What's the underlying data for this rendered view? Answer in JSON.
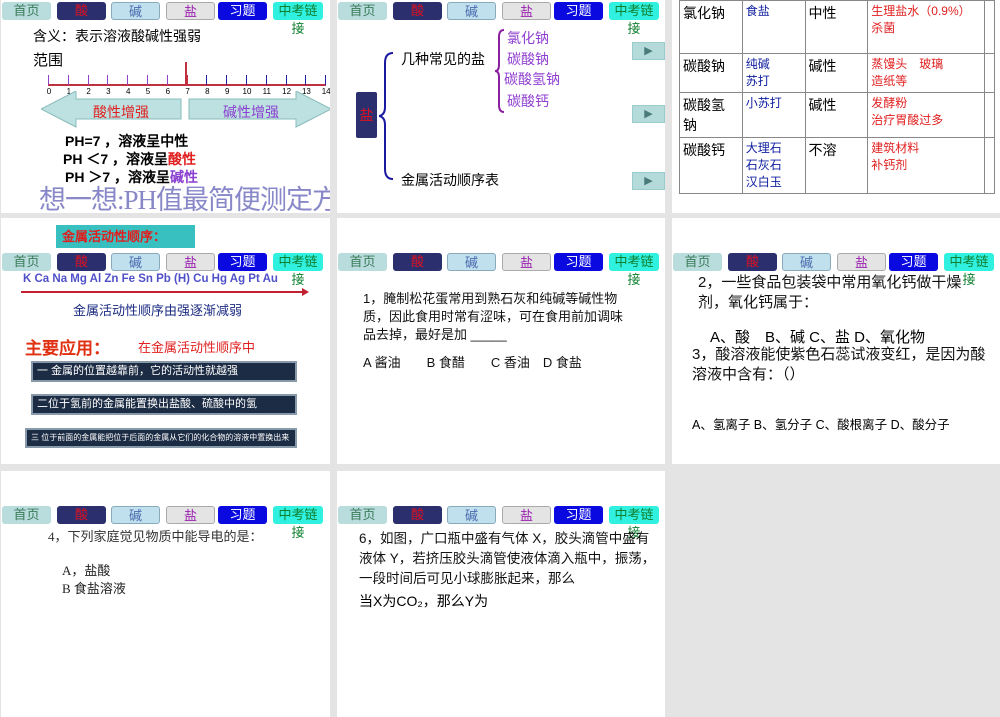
{
  "nav": [
    "首页",
    "酸",
    "碱",
    "盐",
    "习题",
    "中考链接"
  ],
  "slide1": {
    "meaning": "含义：表示溶液酸碱性强弱",
    "range": "范围",
    "ticks": [
      "0",
      "1",
      "2",
      "3",
      "4",
      "5",
      "6",
      "7",
      "8",
      "9",
      "10",
      "11",
      "12",
      "13",
      "14"
    ],
    "acid_arrow": "酸性增强",
    "base_arrow": "碱性增强",
    "line1": "PH=7 ，溶液呈中性",
    "line2_prefix": "PH ＜7 ，溶液呈",
    "line2_colored": "酸性",
    "line3_prefix": "PH ＞7 ，溶液呈",
    "line3_colored": "碱性",
    "think": "想一想:PH值最简便测定方法"
  },
  "slide2": {
    "root": "盐",
    "branch1": "几种常见的盐",
    "salts": [
      "氯化钠",
      "碳酸钠",
      "碳酸氢钠",
      "碳酸钙"
    ],
    "branch2": "金属活动顺序表",
    "play": "▶"
  },
  "slide3": {
    "rows": [
      {
        "name": "氯化钠",
        "common": [
          "食盐"
        ],
        "prop": "中性",
        "use": [
          "生理盐水（0.9%）",
          "杀菌"
        ]
      },
      {
        "name": "碳酸钠",
        "common": [
          "纯碱",
          "苏打"
        ],
        "prop": "碱性",
        "use": [
          "蒸馒头　玻璃",
          "造纸等"
        ]
      },
      {
        "name": "碳酸氢钠",
        "common": [
          "小苏打"
        ],
        "prop": "碱性",
        "use": [
          "发酵粉",
          "治疗胃酸过多"
        ]
      },
      {
        "name": "碳酸钙",
        "common": [
          "大理石",
          "石灰石",
          "汉白玉"
        ],
        "prop": "不溶",
        "use": [
          "建筑材料",
          "补钙剂"
        ]
      }
    ]
  },
  "slide4": {
    "title": "金属活动性顺序：",
    "metals": "K Ca Na Mg Al Zn Fe Sn Pb (H)  Cu Hg Ag Pt Au",
    "order": "金属活动性顺序由强逐渐减弱",
    "app_label": "主要应用：",
    "app_ctx": "在金属活动性顺序中",
    "rules": [
      "一  金属的位置越靠前，它的活动性就越强",
      "二位于氢前的金属能置换出盐酸、硫酸中的氢",
      "三  位于前面的金属能把位于后面的金属从它们的化合物的溶液中置换出来"
    ]
  },
  "slide5": {
    "question": "1，腌制松花蛋常用到熟石灰和纯碱等碱性物质，因此食用时常有涩味，可在食用前加调味品去掉，最好是加 _____",
    "options": "A 酱油　　B 食醋　　C 香油　D 食盐"
  },
  "slide6": {
    "q2": "2，一些食品包装袋中常用氧化钙做干燥剂，氧化钙属于：",
    "q2_options": "A、酸　B、碱  C、盐  D、氧化物",
    "q3": "3，酸溶液能使紫色石蕊试液变红，是因为酸溶液中含有：（）",
    "q3_options": "A、氢离子 B、氢分子 C、酸根离子 D、酸分子"
  },
  "slide7": {
    "q4": "4，下列家庭觉见物质中能导电的是：",
    "a": "A，盐酸",
    "b": "B  食盐溶液"
  },
  "slide8": {
    "q6": "6，如图，广口瓶中盛有气体 X，胶头滴管中盛有液体 Y，若挤压胶头滴管使液体滴入瓶中，振荡，一段时间后可见小球膨胀起来，那么",
    "cut": "当X为CO₂，那么Y为"
  }
}
